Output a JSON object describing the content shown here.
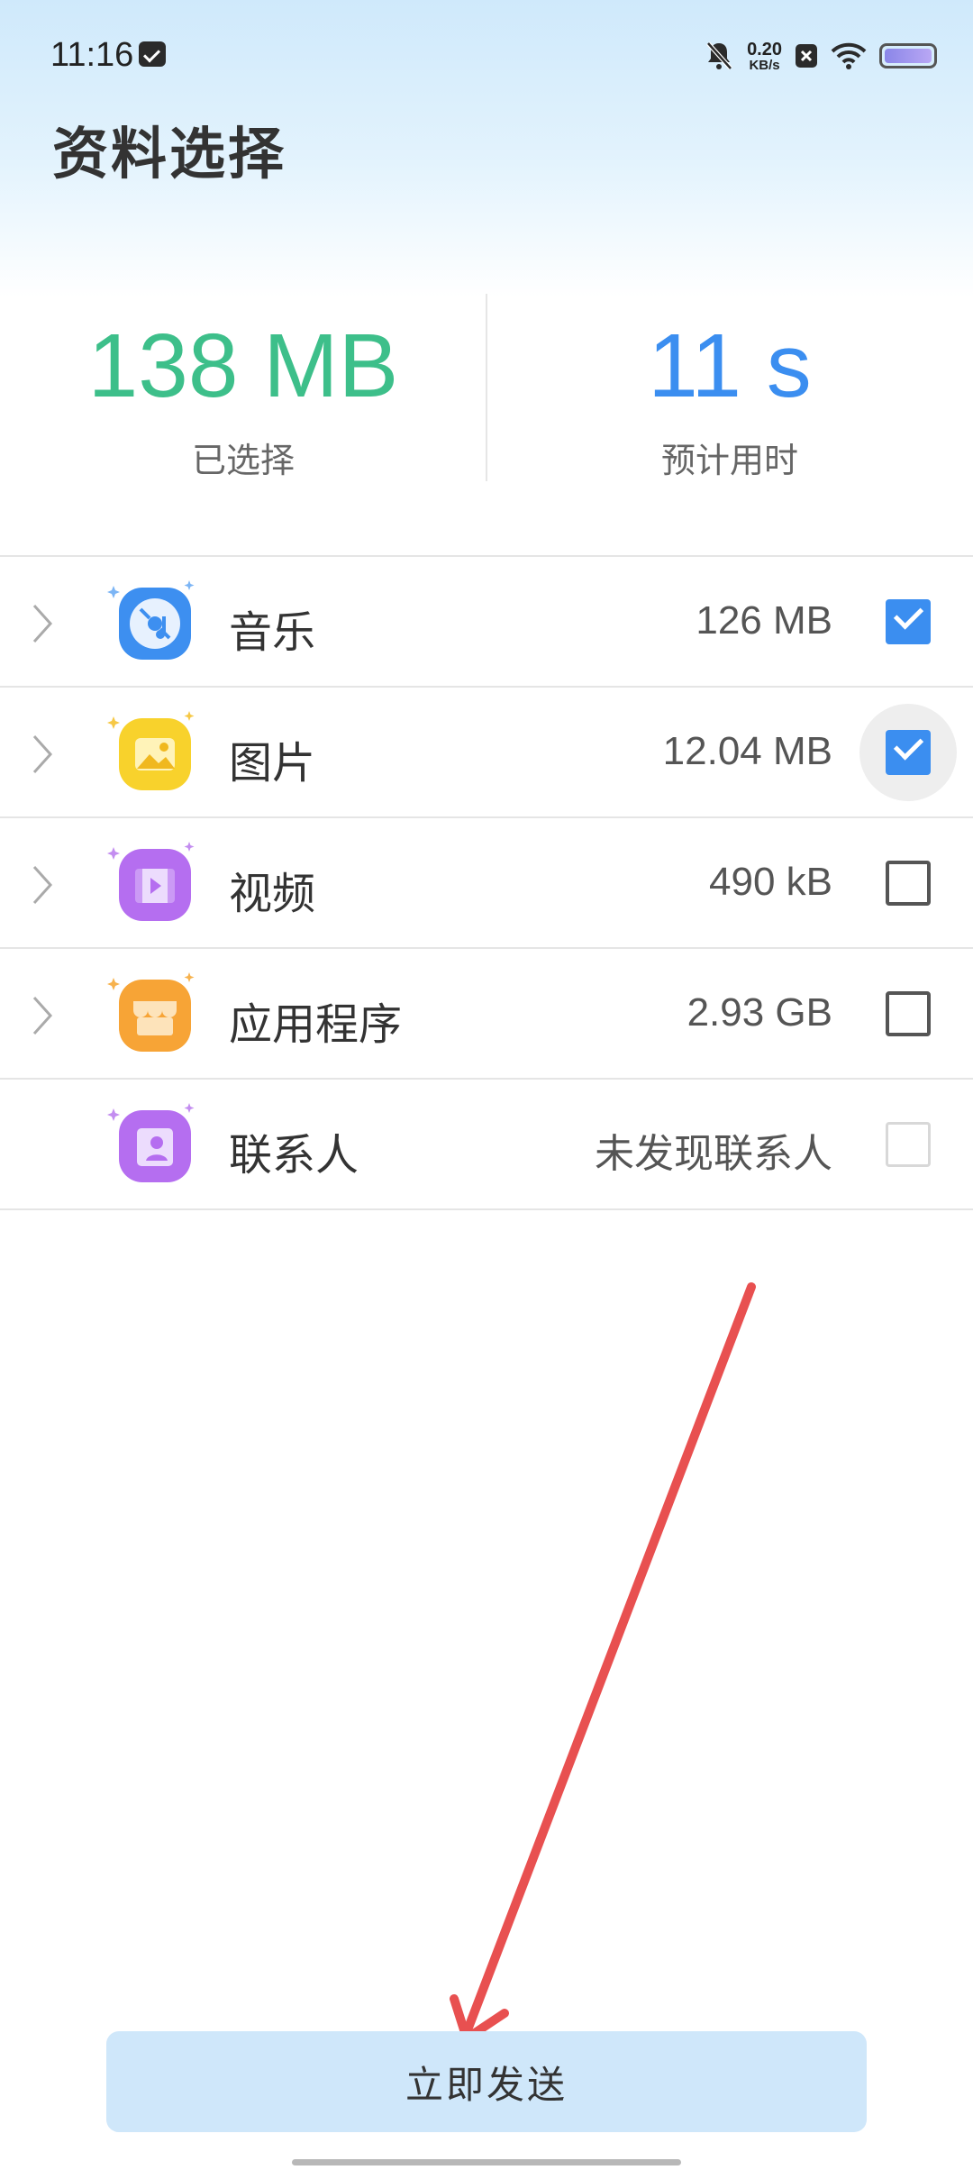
{
  "status_bar": {
    "time": "11:16",
    "net_speed_value": "0.20",
    "net_speed_unit": "KB/s",
    "icons": [
      "message-icon",
      "mute-bell-icon",
      "sim-off-icon",
      "wifi-icon",
      "battery-icon"
    ]
  },
  "page": {
    "title": "资料选择"
  },
  "summary": {
    "selected_value": "138 MB",
    "selected_label": "已选择",
    "time_value": "11 s",
    "time_label": "预计用时"
  },
  "categories": [
    {
      "label": "音乐",
      "size": "126 MB",
      "checked": true,
      "icon": "music-disc-icon"
    },
    {
      "label": "图片",
      "size": "12.04 MB",
      "checked": true,
      "icon": "picture-icon"
    },
    {
      "label": "视频",
      "size": "490 kB",
      "checked": false,
      "icon": "video-film-icon"
    },
    {
      "label": "应用程序",
      "size": "2.93 GB",
      "checked": false,
      "icon": "app-store-icon"
    },
    {
      "label": "联系人",
      "size": "未发现联系人",
      "checked": false,
      "disabled": true,
      "icon": "contacts-icon"
    }
  ],
  "actions": {
    "send_label": "立即发送"
  },
  "annotation": {
    "arrow_color": "#e85050"
  },
  "colors": {
    "green": "#3dbf8a",
    "blue": "#3b8ef0",
    "button_bg": "#cfe7fa"
  }
}
